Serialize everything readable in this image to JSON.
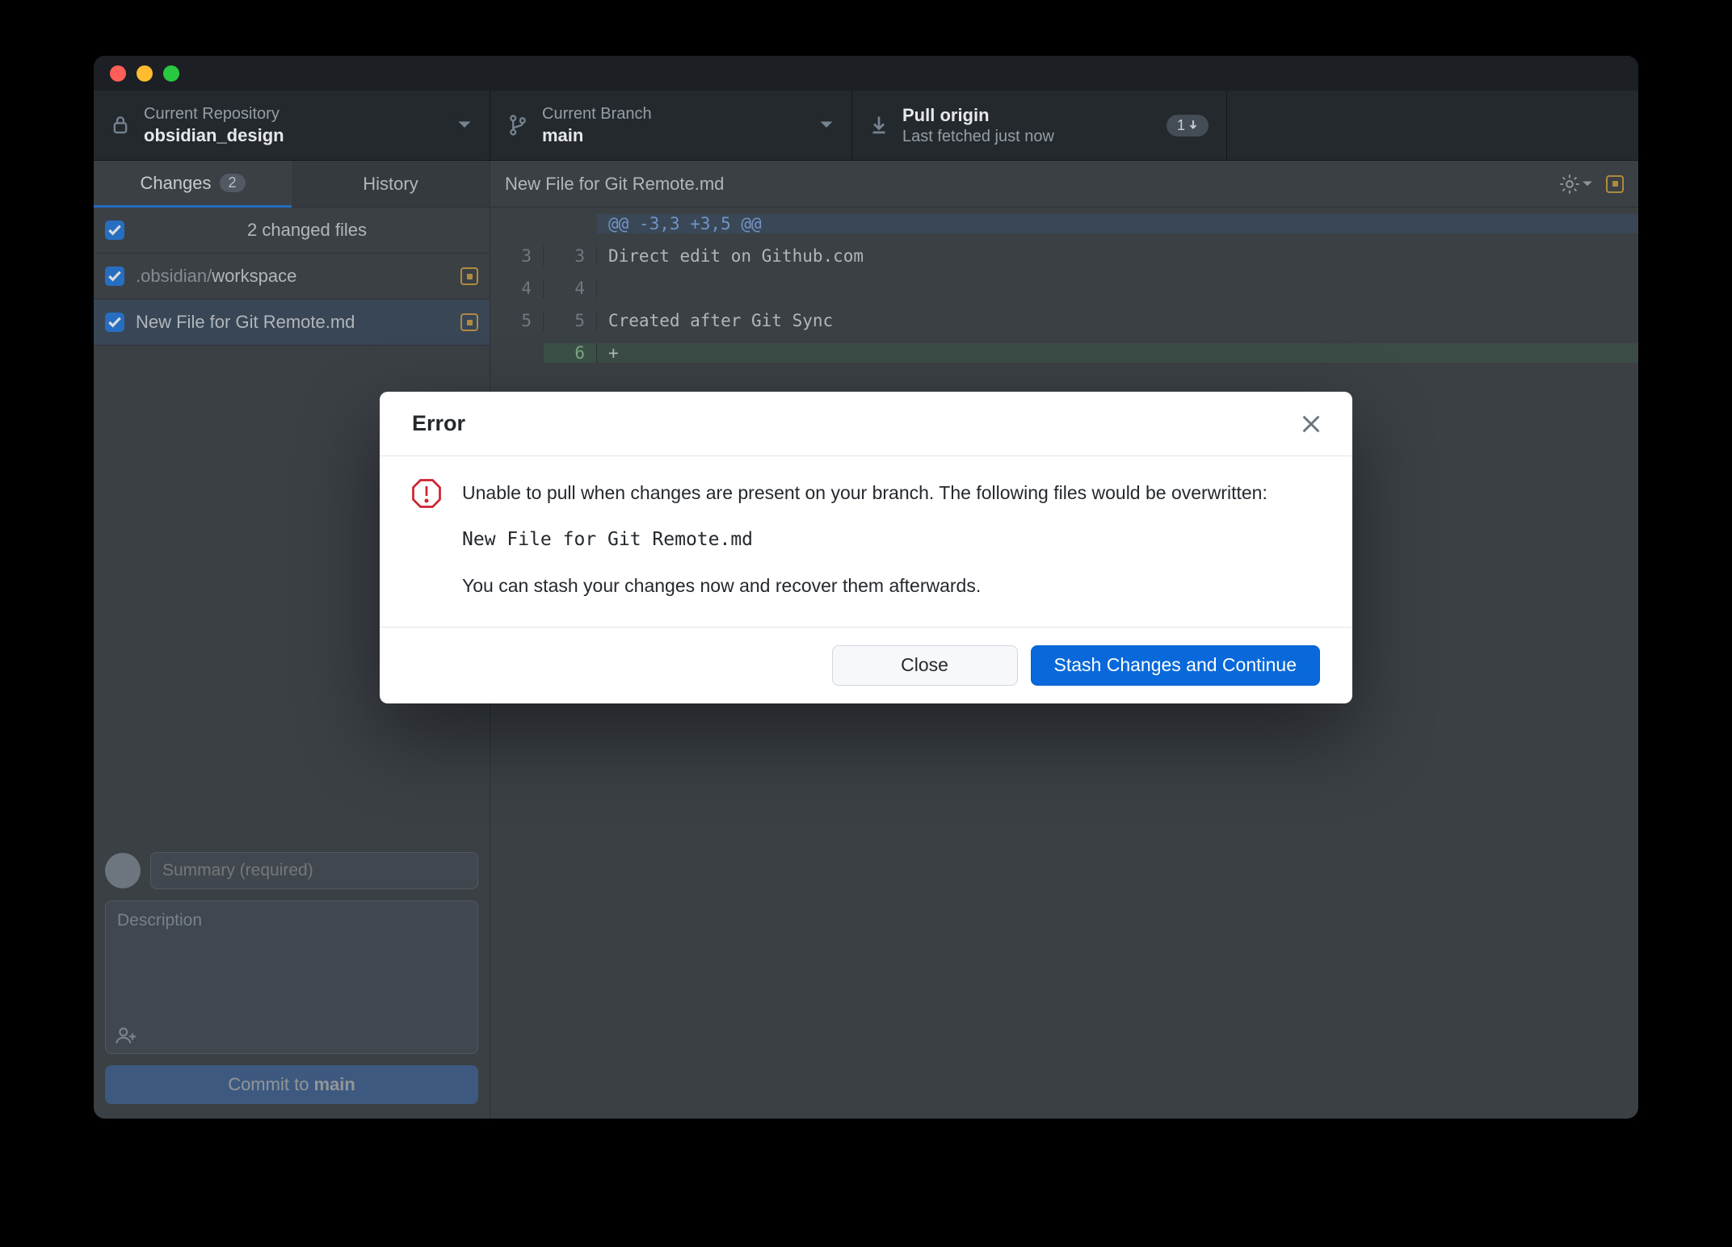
{
  "toolbar": {
    "repo": {
      "label": "Current Repository",
      "value": "obsidian_design"
    },
    "branch": {
      "label": "Current Branch",
      "value": "main"
    },
    "pull": {
      "label": "Pull origin",
      "sub": "Last fetched just now",
      "badge": "1"
    }
  },
  "sidebar": {
    "tabs": {
      "changes": "Changes",
      "changes_count": "2",
      "history": "History"
    },
    "header": "2 changed files",
    "files": [
      {
        "dim": ".obsidian/",
        "name": "workspace"
      },
      {
        "dim": "",
        "name": "New File for Git Remote.md"
      }
    ],
    "summary_placeholder": "Summary (required)",
    "description_placeholder": "Description",
    "commit_prefix": "Commit to ",
    "commit_branch": "main"
  },
  "diff": {
    "file": "New File for Git Remote.md",
    "hunk": "@@ -3,3 +3,5 @@",
    "lines": [
      {
        "a": "3",
        "b": "3",
        "kind": "ctx",
        "text": "Direct edit on Github.com"
      },
      {
        "a": "4",
        "b": "4",
        "kind": "ctx",
        "text": ""
      },
      {
        "a": "5",
        "b": "5",
        "kind": "ctx",
        "text": "Created after Git Sync"
      },
      {
        "a": "",
        "b": "6",
        "kind": "add",
        "text": "+"
      }
    ]
  },
  "modal": {
    "title": "Error",
    "line1": "Unable to pull when changes are present on your branch. The following files would be overwritten:",
    "file": "New File for Git Remote.md",
    "line2": "You can stash your changes now and recover them afterwards.",
    "close": "Close",
    "primary": "Stash Changes and Continue"
  }
}
